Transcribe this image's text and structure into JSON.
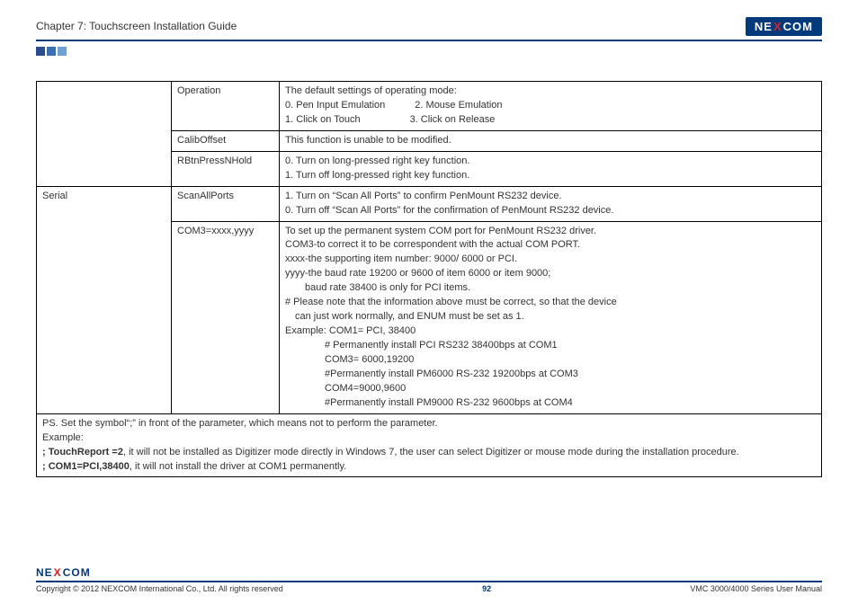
{
  "header": {
    "chapter": "Chapter 7: Touchscreen Installation Guide",
    "logo_pre": "NE",
    "logo_x": "X",
    "logo_post": "COM"
  },
  "table": {
    "rows": [
      {
        "c1": "",
        "c2": "Operation",
        "c3_lines": [
          "The default settings of operating mode:",
          "0. Pen Input Emulation   2. Mouse Emulation",
          "1. Click on Touch     3. Click on Release"
        ]
      },
      {
        "c1": "",
        "c2": "CalibOffset",
        "c3_lines": [
          "This function is unable to be modified."
        ]
      },
      {
        "c1": "",
        "c2": "RBtnPressNHold",
        "c3_lines": [
          "0. Turn on long-pressed right key function.",
          "1. Turn off long-pressed right key function."
        ]
      },
      {
        "c1": "Serial",
        "c2": "ScanAllPorts",
        "c3_lines": [
          "1. Turn on “Scan All Ports” to confirm PenMount RS232 device.",
          "0. Turn off “Scan All Ports” for the confirmation of PenMount RS232 device."
        ]
      },
      {
        "c1": "",
        "c2": "COM3=xxxx,yyyy",
        "c3_lines": [
          "To set up the permanent system COM port for PenMount RS232 driver.",
          "COM3-to correct it to be correspondent with the actual COM PORT.",
          "xxxx-the supporting item number: 9000/ 6000 or PCI.",
          "yyyy-the baud rate 19200 or 9600 of item 6000 or item 9000;",
          "  baud rate 38400 is only for PCI items.",
          "# Please note that the information above must be correct, so that the device",
          " can just work normally, and ENUM must be set as 1.",
          "Example: COM1= PCI, 38400",
          "    # Permanently install PCI RS232 38400bps at COM1",
          "    COM3= 6000,19200",
          "    #Permanently install PM6000 RS-232 19200bps at COM3",
          "    COM4=9000,9600",
          "    #Permanently install PM9000 RS-232 9600bps at COM4"
        ]
      }
    ],
    "note": {
      "line1": "PS. Set the symbol“;” in front of the parameter, which means not to perform the parameter.",
      "line2": "Example:",
      "line3_bold": "; TouchReport =2",
      "line3_rest": ", it will not be installed as Digitizer mode directly in Windows 7, the user can select Digitizer or mouse mode during the installation procedure.",
      "line4_bold": "; COM1=PCI,38400",
      "line4_rest": ", it will not install the driver at COM1 permanently."
    }
  },
  "footer": {
    "copyright": "Copyright © 2012 NEXCOM International Co., Ltd. All rights reserved",
    "page": "92",
    "manual": "VMC 3000/4000 Series User Manual"
  }
}
